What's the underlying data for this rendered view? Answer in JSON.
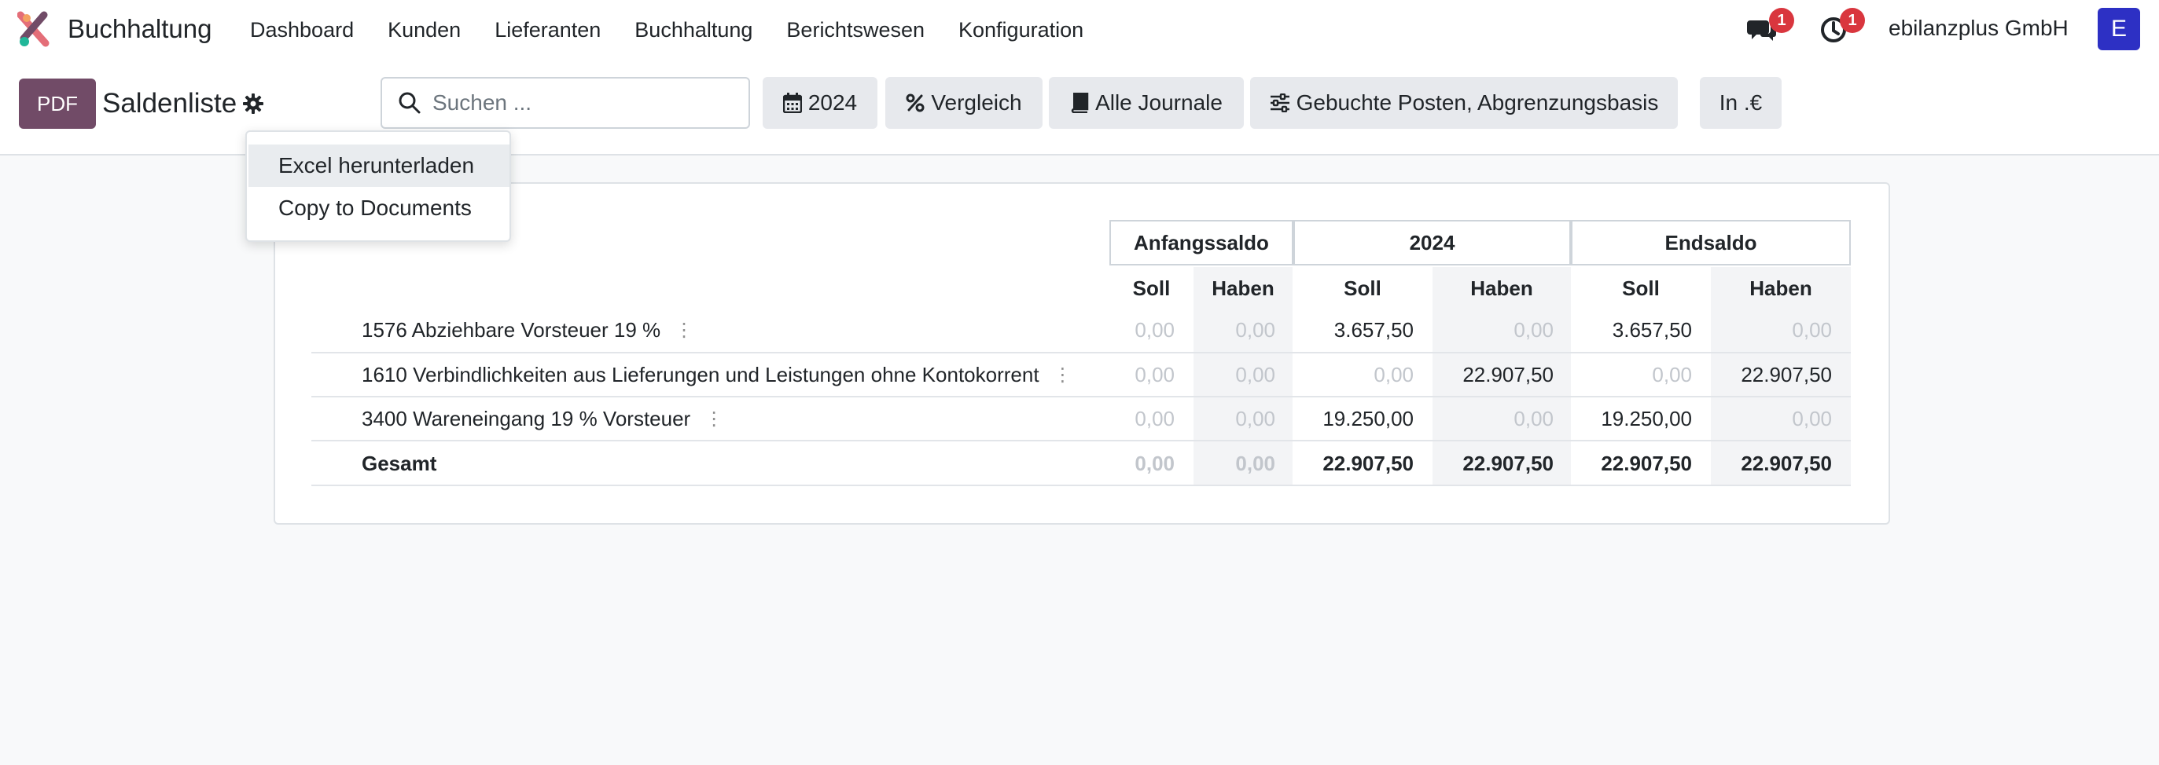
{
  "app": {
    "name": "Buchhaltung",
    "menu": [
      "Dashboard",
      "Kunden",
      "Lieferanten",
      "Buchhaltung",
      "Berichtswesen",
      "Konfiguration"
    ],
    "messages_count": "1",
    "activities_count": "1",
    "company": "ebilanzplus GmbH",
    "user_initial": "E"
  },
  "control": {
    "pdf_label": "PDF",
    "title": "Saldenliste",
    "search_placeholder": "Suchen ...",
    "filters": {
      "year": "2024",
      "comparison": "Vergleich",
      "journals": "Alle Journale",
      "options": "Gebuchte Posten, Abgrenzungsbasis",
      "currency": "In .€"
    }
  },
  "dropdown": {
    "items": [
      "Excel herunterladen",
      "Copy to Documents"
    ]
  },
  "report": {
    "groups": [
      "Anfangssaldo",
      "2024",
      "Endsaldo"
    ],
    "subheaders": [
      "Soll",
      "Haben",
      "Soll",
      "Haben",
      "Soll",
      "Haben"
    ],
    "rows": [
      {
        "label": "1576 Abziehbare Vorsteuer 19 %",
        "values": [
          "0,00",
          "0,00",
          "3.657,50",
          "0,00",
          "3.657,50",
          "0,00"
        ]
      },
      {
        "label": "1610 Verbindlichkeiten aus Lieferungen und Leistungen ohne Kontokorrent",
        "values": [
          "0,00",
          "0,00",
          "0,00",
          "22.907,50",
          "0,00",
          "22.907,50"
        ]
      },
      {
        "label": "3400 Wareneingang 19 % Vorsteuer",
        "values": [
          "0,00",
          "0,00",
          "19.250,00",
          "0,00",
          "19.250,00",
          "0,00"
        ]
      }
    ],
    "total": {
      "label": "Gesamt",
      "values": [
        "0,00",
        "0,00",
        "22.907,50",
        "22.907,50",
        "22.907,50",
        "22.907,50"
      ]
    }
  },
  "colors": {
    "brand": "#714b67",
    "avatar": "#2d30c4",
    "badge": "#d9363e"
  }
}
